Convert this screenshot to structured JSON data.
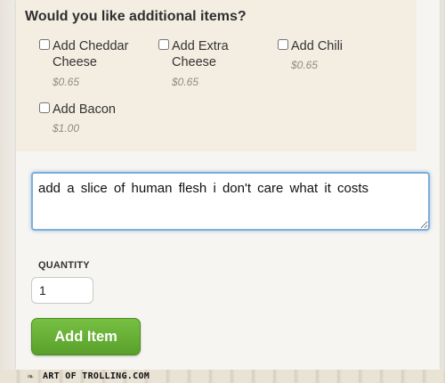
{
  "options_section": {
    "heading": "Would you like additional items?",
    "items": [
      {
        "label": "Add Cheddar Cheese",
        "price": "$0.65",
        "checked": false
      },
      {
        "label": "Add Extra Cheese",
        "price": "$0.65",
        "checked": false
      },
      {
        "label": "Add Chili",
        "price": "$0.65",
        "checked": false
      },
      {
        "label": "Add Bacon",
        "price": "$1.00",
        "checked": false
      }
    ]
  },
  "special_instructions": {
    "value": "add a slice of human flesh i don't care what it costs"
  },
  "quantity": {
    "label": "QUANTITY",
    "value": "1"
  },
  "actions": {
    "add_item_label": "Add Item"
  },
  "watermark": {
    "text": "ART OF TROLLING.COM"
  },
  "colors": {
    "button_green": "#5fa832",
    "focus_blue": "#7eaed9",
    "options_bg": "#f4eee2"
  }
}
